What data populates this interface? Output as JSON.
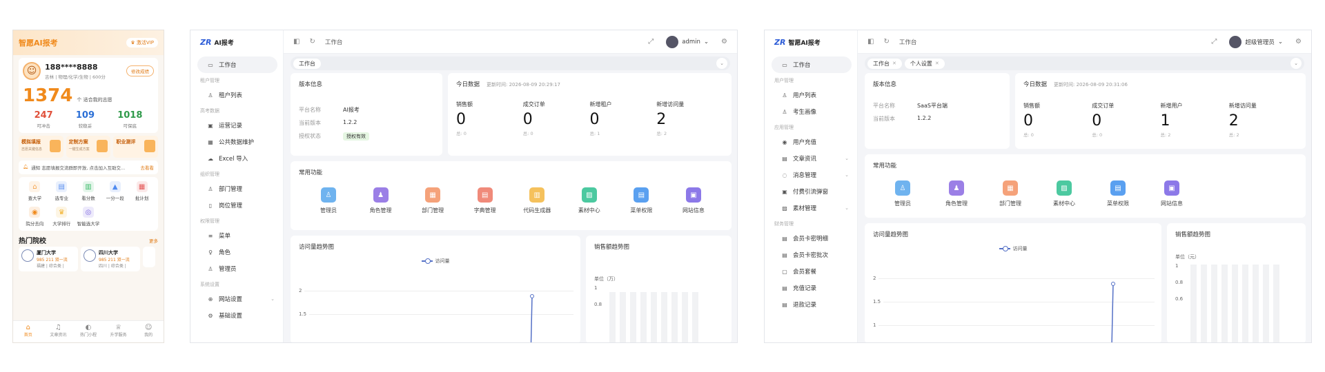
{
  "mobile": {
    "brand": "智愿AI报考",
    "vip": "♛ 激活VIP",
    "phone": "188****8888",
    "profile_sub": "吉林 | 物理/化学/生物 | 600分",
    "edit": "修改成绩",
    "big_number": "1374",
    "big_text": "个 适合我的志愿",
    "stats": [
      {
        "value": "247",
        "label": "可冲击",
        "color": "#e0513b"
      },
      {
        "value": "109",
        "label": "较稳妥",
        "color": "#2b6fd6"
      },
      {
        "value": "1018",
        "label": "可保底",
        "color": "#2f9a4a"
      }
    ],
    "features": [
      {
        "title": "模拟填报",
        "sub": "志愿关键信息"
      },
      {
        "title": "定制方案",
        "sub": "一键生成方案"
      },
      {
        "title": "职业测评",
        "sub": ""
      }
    ],
    "notice": "通知 志愿填报交流群即开放, 点击加入互助交...",
    "notice_more": "去看看",
    "grid": [
      {
        "label": "查大学",
        "icon": "⌂",
        "color": "#f4a24a"
      },
      {
        "label": "选专业",
        "icon": "▤",
        "color": "#5b8ff0"
      },
      {
        "label": "看分数",
        "icon": "▥",
        "color": "#3dbb6b"
      },
      {
        "label": "一分一段",
        "icon": "▲",
        "color": "#4f8af0"
      },
      {
        "label": "批计划",
        "icon": "▦",
        "color": "#e45757"
      },
      {
        "label": "院分去向",
        "icon": "◉",
        "color": "#f08a1c"
      },
      {
        "label": "大学排行",
        "icon": "♛",
        "color": "#f2b332"
      },
      {
        "label": "智能选大学",
        "icon": "◎",
        "color": "#7a63e0"
      }
    ],
    "hot_title": "热门院校",
    "hot_more": "更多",
    "schools": [
      {
        "name": "厦门大学",
        "tags": "985 211 双一流",
        "addr": "福建 | 综合类 |"
      },
      {
        "name": "四川大学",
        "tags": "985 211 双一流",
        "addr": "四川 | 综合类 |"
      }
    ],
    "tabs": [
      {
        "label": "首页",
        "icon": "⌂"
      },
      {
        "label": "文章资讯",
        "icon": "♫"
      },
      {
        "label": "热门小程",
        "icon": "◐"
      },
      {
        "label": "升学服务",
        "icon": "♕"
      },
      {
        "label": "我的",
        "icon": "☺"
      }
    ]
  },
  "admin1": {
    "logo_zr": "ZR",
    "logo": "AI报考",
    "crumb": "工作台",
    "user": "admin",
    "nav": [
      {
        "type": "item",
        "label": "工作台",
        "icon": "▭",
        "active": true
      },
      {
        "type": "group",
        "label": "租户管理"
      },
      {
        "type": "item",
        "label": "租户列表",
        "icon": "♙"
      },
      {
        "type": "group",
        "label": "高考数据"
      },
      {
        "type": "item",
        "label": "运营记录",
        "icon": "▣"
      },
      {
        "type": "item",
        "label": "公共数据维护",
        "icon": "▦"
      },
      {
        "type": "item",
        "label": "Excel 导入",
        "icon": "☁"
      },
      {
        "type": "group",
        "label": "组织管理"
      },
      {
        "type": "item",
        "label": "部门管理",
        "icon": "♙"
      },
      {
        "type": "item",
        "label": "岗位管理",
        "icon": "▯"
      },
      {
        "type": "group",
        "label": "权限管理"
      },
      {
        "type": "item",
        "label": "菜单",
        "icon": "≡"
      },
      {
        "type": "item",
        "label": "角色",
        "icon": "♀"
      },
      {
        "type": "item",
        "label": "管理员",
        "icon": "♙"
      },
      {
        "type": "group",
        "label": "系统设置"
      },
      {
        "type": "item",
        "label": "网站设置",
        "icon": "⊕",
        "chev": true
      },
      {
        "type": "item",
        "label": "基础设置",
        "icon": "⚙"
      }
    ],
    "tabs": [
      "工作台"
    ],
    "version_title": "版本信息",
    "version": [
      {
        "k": "平台名称",
        "v": "AI报考"
      },
      {
        "k": "当前版本",
        "v": "1.2.2"
      },
      {
        "k": "授权状态",
        "v": "授权有效",
        "badge": true
      }
    ],
    "today_title": "今日数据",
    "today_time": "更新时间: 2026-08-09 20:29:17",
    "today": [
      {
        "l": "销售额",
        "v": "0",
        "s": "总: 0"
      },
      {
        "l": "成交订单",
        "v": "0",
        "s": "总: 0"
      },
      {
        "l": "新增租户",
        "v": "0",
        "s": "总: 1"
      },
      {
        "l": "新增访问量",
        "v": "2",
        "s": "总: 2"
      }
    ],
    "func_title": "常用功能",
    "funcs": [
      {
        "l": "管理员",
        "c": "#6fb3ef",
        "i": "♙"
      },
      {
        "l": "角色管理",
        "c": "#9b7fe6",
        "i": "♟"
      },
      {
        "l": "部门管理",
        "c": "#f5a27a",
        "i": "▦"
      },
      {
        "l": "字典管理",
        "c": "#f08a7a",
        "i": "▤"
      },
      {
        "l": "代码生成器",
        "c": "#f5c15c",
        "i": "▥"
      },
      {
        "l": "素材中心",
        "c": "#4cc9a0",
        "i": "▨"
      },
      {
        "l": "菜单权限",
        "c": "#5aa0f0",
        "i": "▤"
      },
      {
        "l": "网站信息",
        "c": "#8c79e8",
        "i": "▣"
      }
    ],
    "trend_title": "访问量趋势图",
    "trend_legend": "访问量",
    "trend_ticks": [
      "2",
      "1.5"
    ],
    "sales_title": "销售额趋势图",
    "sales_unit": "单位（万）",
    "sales_ticks": [
      "1",
      "0.8"
    ]
  },
  "admin2": {
    "logo_zr": "ZR",
    "logo": "智愿AI报考",
    "crumb": "工作台",
    "user": "超级管理员",
    "nav": [
      {
        "type": "item",
        "label": "工作台",
        "icon": "▭",
        "active": true
      },
      {
        "type": "group",
        "label": "用户管理"
      },
      {
        "type": "item",
        "label": "用户列表",
        "icon": "♙"
      },
      {
        "type": "item",
        "label": "考生画像",
        "icon": "♙"
      },
      {
        "type": "group",
        "label": "应用管理"
      },
      {
        "type": "item",
        "label": "用户充值",
        "icon": "◉"
      },
      {
        "type": "item",
        "label": "文章资讯",
        "icon": "▤",
        "chev": true
      },
      {
        "type": "item",
        "label": "消息管理",
        "icon": "◌",
        "chev": true
      },
      {
        "type": "item",
        "label": "付费引流弹窗",
        "icon": "▣"
      },
      {
        "type": "item",
        "label": "素材管理",
        "icon": "▨",
        "chev": true
      },
      {
        "type": "group",
        "label": "财务管理"
      },
      {
        "type": "item",
        "label": "会员卡密明细",
        "icon": "▤"
      },
      {
        "type": "item",
        "label": "会员卡密批次",
        "icon": "▤"
      },
      {
        "type": "item",
        "label": "会员套餐",
        "icon": "▢"
      },
      {
        "type": "item",
        "label": "充值记录",
        "icon": "▤"
      },
      {
        "type": "item",
        "label": "退款记录",
        "icon": "▤"
      }
    ],
    "tabs": [
      "工作台",
      "个人设置"
    ],
    "version_title": "版本信息",
    "version": [
      {
        "k": "平台名称",
        "v": "SaaS平台端"
      },
      {
        "k": "当前版本",
        "v": "1.2.2"
      }
    ],
    "today_title": "今日数据",
    "today_time": "更新时间: 2026-08-09 20:31:06",
    "today": [
      {
        "l": "销售额",
        "v": "0",
        "s": "总: 0"
      },
      {
        "l": "成交订单",
        "v": "0",
        "s": "总: 0"
      },
      {
        "l": "新增用户",
        "v": "1",
        "s": "总: 2"
      },
      {
        "l": "新增访问量",
        "v": "2",
        "s": "总: 2"
      }
    ],
    "func_title": "常用功能",
    "funcs": [
      {
        "l": "管理员",
        "c": "#6fb3ef",
        "i": "♙"
      },
      {
        "l": "角色管理",
        "c": "#9b7fe6",
        "i": "♟"
      },
      {
        "l": "部门管理",
        "c": "#f5a27a",
        "i": "▦"
      },
      {
        "l": "素材中心",
        "c": "#4cc9a0",
        "i": "▨"
      },
      {
        "l": "菜单权限",
        "c": "#5aa0f0",
        "i": "▤"
      },
      {
        "l": "网站信息",
        "c": "#8c79e8",
        "i": "▣"
      }
    ],
    "trend_title": "访问量趋势图",
    "trend_legend": "访问量",
    "trend_ticks": [
      "2",
      "1.5",
      "1"
    ],
    "sales_title": "销售额趋势图",
    "sales_unit": "单位（元）",
    "sales_ticks": [
      "1",
      "0.8",
      "0.6"
    ]
  }
}
